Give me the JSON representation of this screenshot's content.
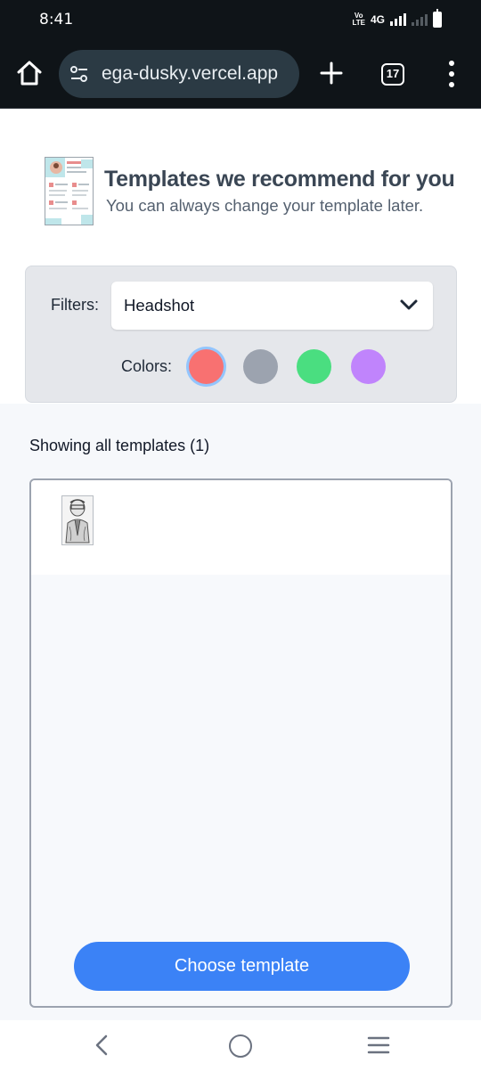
{
  "status_bar": {
    "time": "8:41",
    "volte": "Vo\nLTE",
    "network": "4G"
  },
  "browser": {
    "url": "ega-dusky.vercel.app",
    "tab_count": "17",
    "icons": [
      "home-icon",
      "site-settings-icon",
      "new-tab-plus-icon",
      "tab-switcher-icon",
      "overflow-menu-icon"
    ]
  },
  "header": {
    "title": "Templates we recommend for you",
    "subtitle": "You can always change your template later."
  },
  "filters": {
    "label": "Filters:",
    "selected": "Headshot",
    "colors_label": "Colors:",
    "colors": [
      {
        "name": "red",
        "hex": "#f87171",
        "selected": true
      },
      {
        "name": "gray",
        "hex": "#9ca3af",
        "selected": false
      },
      {
        "name": "green",
        "hex": "#4ade80",
        "selected": false
      },
      {
        "name": "purple",
        "hex": "#c084fc",
        "selected": false
      }
    ]
  },
  "results": {
    "showing": "Showing all templates (1)"
  },
  "actions": {
    "choose_label": "Choose template"
  },
  "theme": {
    "primary": "#3b82f6",
    "browser_bg": "#0f1418",
    "url_pill": "#2b3a44"
  }
}
